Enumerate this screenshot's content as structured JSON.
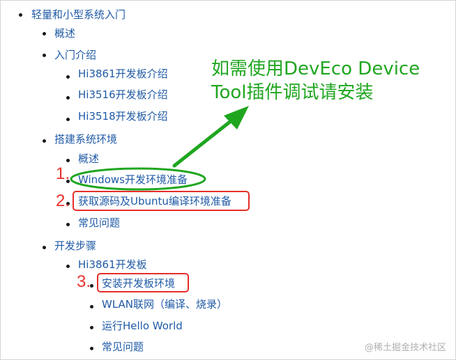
{
  "tree": {
    "root": "轻量和小型系统入门",
    "overview": "概述",
    "intro": {
      "label": "入门介绍",
      "items": [
        "Hi3861开发板介绍",
        "Hi3516开发板介绍",
        "Hi3518开发板介绍"
      ]
    },
    "setup": {
      "label": "搭建系统环境",
      "items": [
        "概述",
        "Windows开发环境准备",
        "获取源码及Ubuntu编译环境准备",
        "常见问题"
      ]
    },
    "steps": {
      "label": "开发步骤",
      "board": "Hi3861开发板",
      "items": [
        "安装开发板环境",
        "WLAN联网（编译、烧录）",
        "运行Hello World",
        "常见问题"
      ]
    }
  },
  "annotation": {
    "line1": "如需使用DevEco Device",
    "line2": "Tool插件调试请安装",
    "markers": [
      "1.",
      "2.",
      "3."
    ],
    "colors": {
      "green": "#1fa61f",
      "red": "#e52e2a",
      "link": "#1f5aa6"
    }
  },
  "watermark": "@稀土掘金技术社区"
}
